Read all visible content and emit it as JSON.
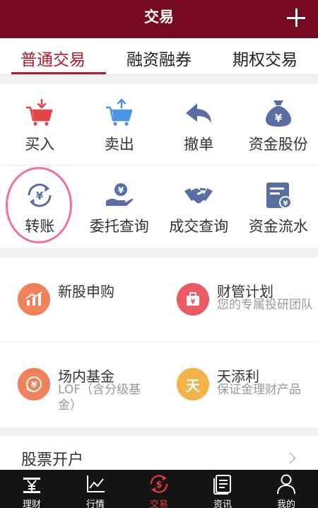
{
  "header": {
    "title": "交易"
  },
  "tabs": [
    {
      "label": "普通交易"
    },
    {
      "label": "融资融券"
    },
    {
      "label": "期权交易"
    }
  ],
  "grid": [
    {
      "label": "买入",
      "icon": "cart-down-icon"
    },
    {
      "label": "卖出",
      "icon": "cart-up-icon"
    },
    {
      "label": "撤单",
      "icon": "undo-arrow-icon"
    },
    {
      "label": "资金股份",
      "icon": "money-bag-icon"
    },
    {
      "label": "转账",
      "icon": "transfer-yuan-icon"
    },
    {
      "label": "委托查询",
      "icon": "hand-yuan-icon"
    },
    {
      "label": "成交查询",
      "icon": "handshake-icon"
    },
    {
      "label": "资金流水",
      "icon": "ledger-icon"
    }
  ],
  "services": [
    {
      "name": "新股申购",
      "desc": "",
      "icon": "chart-icon",
      "color": "#f0825a"
    },
    {
      "name": "财管计划",
      "desc": "您的专属投研团队",
      "icon": "briefcase-icon",
      "color": "#ea5a63"
    },
    {
      "name": "场内基金",
      "desc": "LOF（含分级基金）",
      "icon": "fund-icon",
      "color": "#f0825a"
    },
    {
      "name": "天添利",
      "desc": "保证金理财产品",
      "icon": "tian-icon",
      "color": "#f4b24a",
      "glyph": "天"
    }
  ],
  "open_account": {
    "label": "股票开户"
  },
  "bottom_nav": [
    {
      "label": "理财",
      "icon": "yuan-icon"
    },
    {
      "label": "行情",
      "icon": "line-chart-icon"
    },
    {
      "label": "交易",
      "icon": "dollar-cycle-icon"
    },
    {
      "label": "资讯",
      "icon": "document-icon"
    },
    {
      "label": "我的",
      "icon": "person-icon"
    }
  ],
  "colors": {
    "brand": "#760a1f",
    "accent": "#b51a2c",
    "icon_red": "#e54545",
    "icon_blue": "#4a94e6",
    "icon_slate": "#5a6fa1"
  }
}
